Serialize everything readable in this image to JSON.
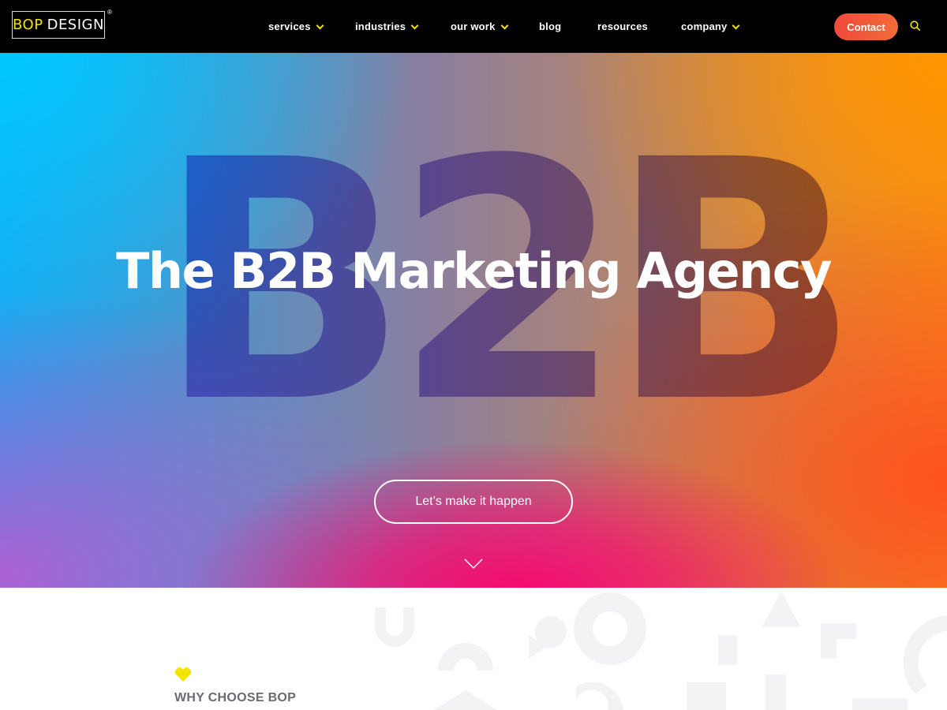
{
  "header": {
    "logo": {
      "word1": "BOP",
      "word2": "DESIGN",
      "reg": "®"
    },
    "nav": [
      {
        "label": "services",
        "has_dropdown": true
      },
      {
        "label": "industries",
        "has_dropdown": true
      },
      {
        "label": "our work",
        "has_dropdown": true
      },
      {
        "label": "blog",
        "has_dropdown": false
      },
      {
        "label": "resources",
        "has_dropdown": false
      },
      {
        "label": "company",
        "has_dropdown": true
      }
    ],
    "contact_label": "Contact",
    "search_icon": "search-icon",
    "colors": {
      "accent_yellow": "#f5e400",
      "contact_bg": "#f05a39",
      "bar_bg": "#000000"
    }
  },
  "hero": {
    "bg_text": "B2B",
    "title": "The B2B Marketing Agency",
    "cta_label": "Let’s make it happen",
    "scroll_icon": "chevron-down-icon"
  },
  "section": {
    "icon": "heart-icon",
    "eyebrow": "WHY CHOOSE BOP"
  }
}
